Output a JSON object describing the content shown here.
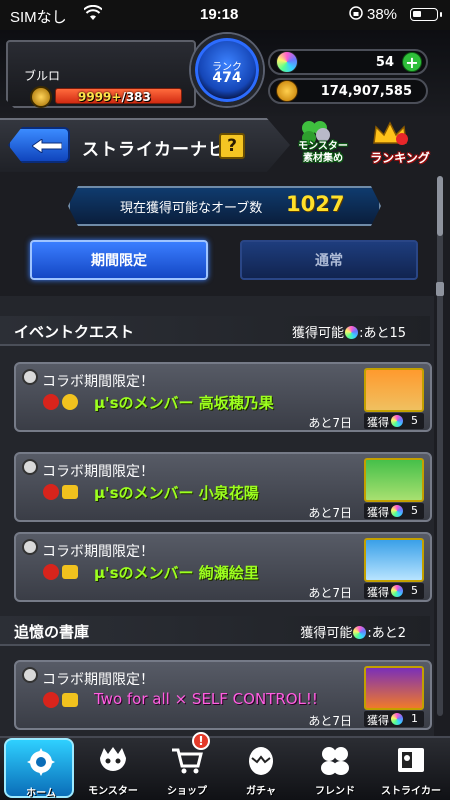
{
  "status_bar": {
    "carrier": "SIMなし",
    "time": "19:18",
    "battery": "38%"
  },
  "player": {
    "name": "ブルロ",
    "stamina_current": "9999+",
    "stamina_max": "/383",
    "rank_label": "ランク",
    "rank": "474",
    "orbs": "54",
    "gold": "174,907,585"
  },
  "nav": {
    "title": "ストライカーナビ",
    "help": "?",
    "monster_collect_line1": "モンスター",
    "monster_collect_line2": "素材集め",
    "ranking": "ランキング"
  },
  "orb_counter": {
    "label": "現在獲得可能なオーブ数",
    "value": "1027"
  },
  "tabs": {
    "limited": "期間限定",
    "normal": "通常"
  },
  "sections": [
    {
      "title": "イベントクエスト",
      "available_prefix": "獲得可能",
      "available_suffix": ":あと15",
      "quests": [
        {
          "category": "コラボ期間限定！",
          "name": "μ'sのメンバー 高坂穂乃果",
          "remaining": "あと7日",
          "gain_label": "獲得",
          "gain": "5"
        },
        {
          "category": "コラボ期間限定！",
          "name": "μ'sのメンバー 小泉花陽",
          "remaining": "あと7日",
          "gain_label": "獲得",
          "gain": "5"
        },
        {
          "category": "コラボ期間限定！",
          "name": "μ'sのメンバー 絢瀬絵里",
          "remaining": "あと7日",
          "gain_label": "獲得",
          "gain": "5"
        }
      ]
    },
    {
      "title": "追憶の書庫",
      "available_prefix": "獲得可能",
      "available_suffix": ":あと2",
      "quests": [
        {
          "category": "コラボ期間限定！",
          "name": "Two for all × SELF CONTROL!!",
          "remaining": "あと7日",
          "gain_label": "獲得",
          "gain": "1"
        }
      ]
    }
  ],
  "bottom_nav": [
    {
      "label": "ホーム",
      "icon": "home-icon"
    },
    {
      "label": "モンスター",
      "icon": "monster-icon"
    },
    {
      "label": "ショップ",
      "icon": "shop-cart-icon",
      "badge": "!"
    },
    {
      "label": "ガチャ",
      "icon": "gacha-egg-icon"
    },
    {
      "label": "フレンド",
      "icon": "friend-icon"
    },
    {
      "label": "ストライカー",
      "icon": "striker-card-icon"
    }
  ],
  "colors": {
    "accent_blue": "#1447c4",
    "quest_name_green": "#9cff1e",
    "quest_name_pink": "#ff5fe1",
    "orb_gold_text": "#ffe02a"
  }
}
